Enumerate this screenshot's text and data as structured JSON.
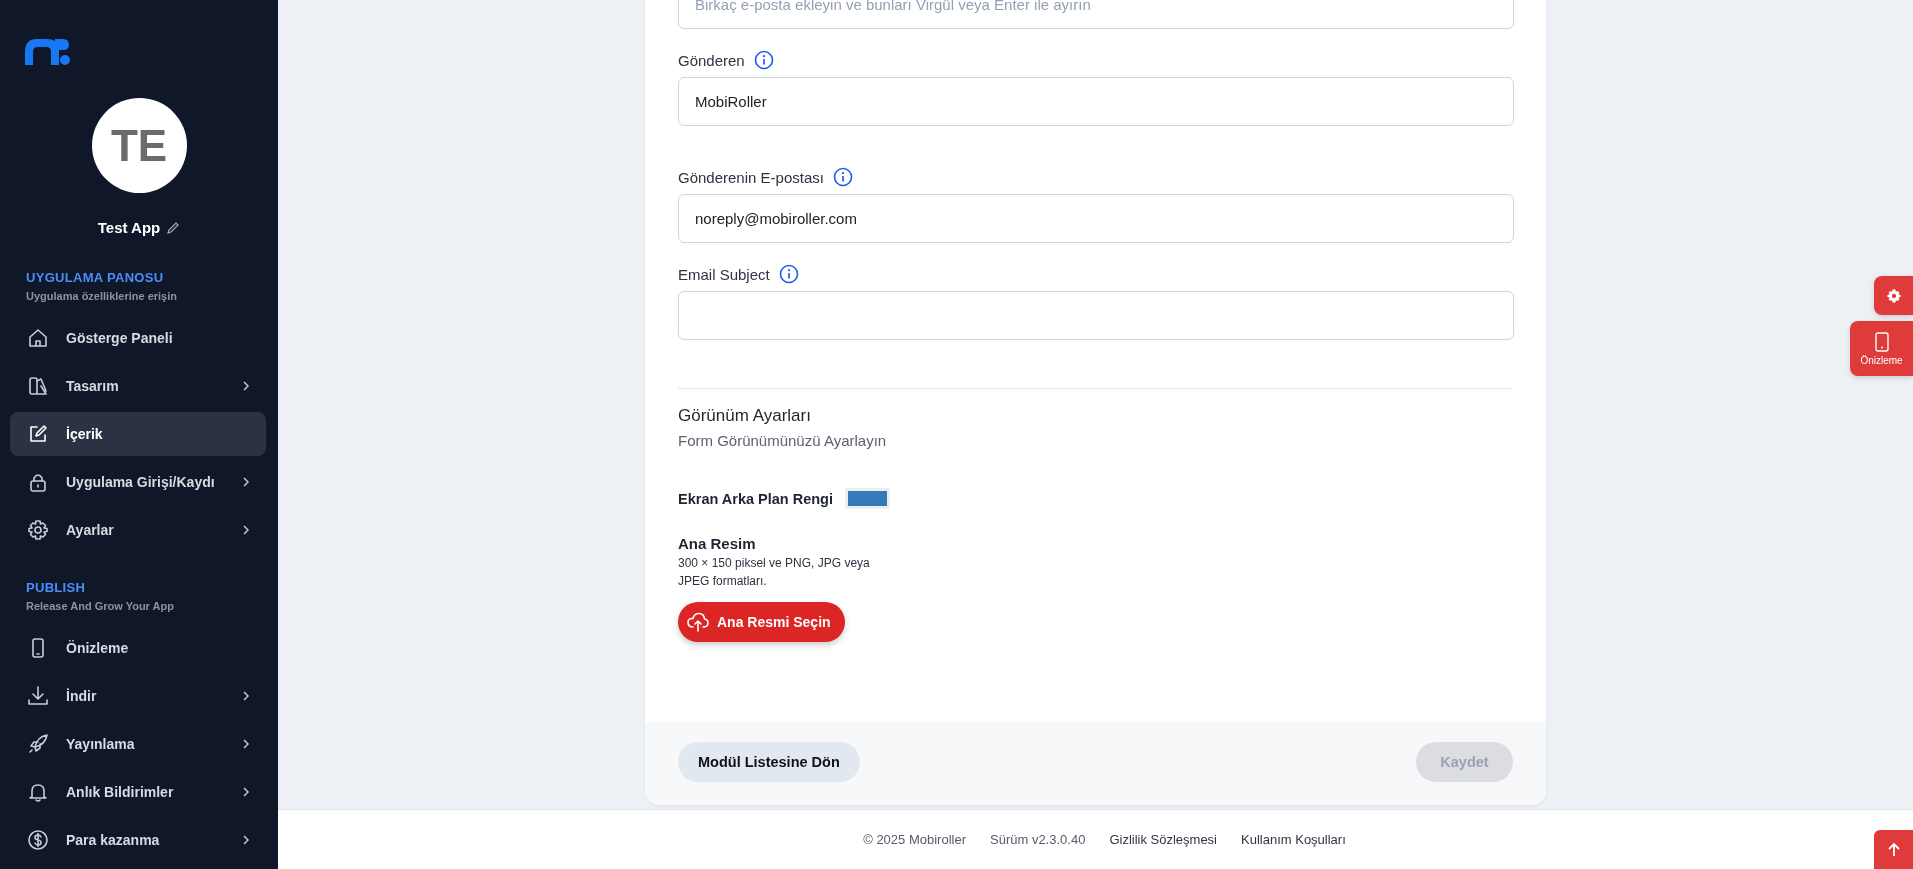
{
  "sidebar": {
    "avatar": {
      "initials": "TE"
    },
    "app_name": "Test App",
    "sections": [
      {
        "title": "UYGULAMA PANOSU",
        "subtitle": "Uygulama özelliklerine erişin",
        "items": [
          {
            "label": "Gösterge Paneli",
            "expandable": false,
            "selected": false
          },
          {
            "label": "Tasarım",
            "expandable": true,
            "selected": false
          },
          {
            "label": "İçerik",
            "expandable": false,
            "selected": true
          },
          {
            "label": "Uygulama Girişi/Kaydı",
            "expandable": true,
            "selected": false
          },
          {
            "label": "Ayarlar",
            "expandable": true,
            "selected": false
          }
        ]
      },
      {
        "title": "PUBLISH",
        "subtitle": "Release And Grow Your App",
        "items": [
          {
            "label": "Önizleme",
            "expandable": false,
            "selected": false
          },
          {
            "label": "İndir",
            "expandable": true,
            "selected": false
          },
          {
            "label": "Yayınlama",
            "expandable": true,
            "selected": false
          },
          {
            "label": "Anlık Bildirimler",
            "expandable": true,
            "selected": false
          },
          {
            "label": "Para kazanma",
            "expandable": true,
            "selected": false
          }
        ]
      }
    ]
  },
  "form": {
    "fields": [
      {
        "placeholder": "Birkaç e-posta ekleyin ve bunları Virgül veya Enter ile ayırın"
      },
      {
        "label": "Gönderen",
        "value": "MobiRoller"
      },
      {
        "label": "Gönderenin E-postası",
        "value": "noreply@mobiroller.com"
      },
      {
        "label": "Email Subject"
      }
    ],
    "appearance": {
      "title": "Görünüm Ayarları",
      "subtitle": "Form Görünümünüzü Ayarlayın",
      "color_label": "Ekran Arka Plan Rengi",
      "color": "#3479b9"
    },
    "image": {
      "title": "Ana Resim",
      "hint": "300 × 150 piksel ve PNG, JPG veya JPEG formatları.",
      "button": "Ana Resmi Seçin"
    },
    "back_button": "Modül Listesine Dön",
    "save_button": {
      "label": "Kaydet",
      "disabled": true
    }
  },
  "floating": {
    "preview_label": "Önizleme"
  },
  "footer": [
    {
      "kind": "text",
      "text": "© 2025 Mobiroller"
    },
    {
      "kind": "text",
      "text": "Sürüm v2.3.0.40"
    },
    {
      "kind": "link",
      "text": "Gizlilik Sözleşmesi"
    },
    {
      "kind": "link",
      "text": "Kullanım Koşulları"
    }
  ]
}
